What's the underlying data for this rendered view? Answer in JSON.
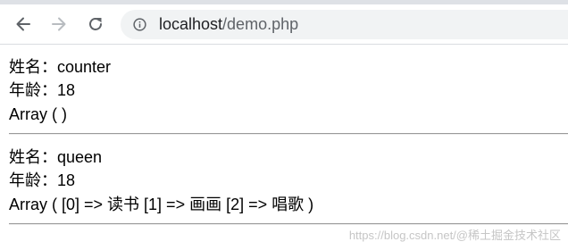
{
  "browser": {
    "url_host": "localhost",
    "url_path": "/demo.php",
    "icons": {
      "back": "back-arrow-icon",
      "forward": "forward-arrow-icon",
      "reload": "reload-icon",
      "info": "info-icon"
    }
  },
  "records": [
    {
      "name_line": "姓名：counter",
      "age_line": "年龄：18",
      "array_line": "Array ( )"
    },
    {
      "name_line": "姓名：queen",
      "age_line": "年龄：18",
      "array_line": "Array ( [0] => 读书 [1] => 画画 [2] => 唱歌 )"
    }
  ],
  "watermark": "https://blog.csdn.net/@稀土掘金技术社区"
}
